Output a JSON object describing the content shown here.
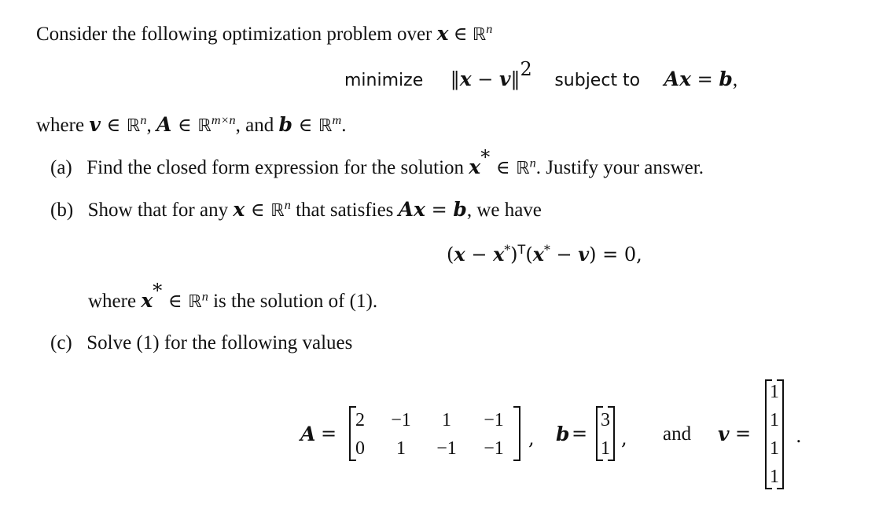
{
  "intro": {
    "text": "Consider the following optimization problem over",
    "var": "x",
    "in": "∈",
    "set": "ℝ",
    "set_exp": "n"
  },
  "problem": {
    "minimize": "minimize",
    "objective_open": "‖",
    "objective_x": "x",
    "objective_minus": " − ",
    "objective_v": "v",
    "objective_close": "‖",
    "objective_exp": "2",
    "subject_to": "subject to",
    "constraint_A": "A",
    "constraint_x": "x",
    "constraint_eq": " = ",
    "constraint_b": "b",
    "constraint_end": ","
  },
  "where_line": {
    "where": "where",
    "v": "v",
    "in": " ∈ ",
    "Rn": "ℝ",
    "n": "n",
    "comma1": ", ",
    "A": "A",
    "Rmn": "ℝ",
    "mxn": "m×n",
    "and": ", and ",
    "b": "b",
    "Rm": "ℝ",
    "m": "m",
    "end": "."
  },
  "parts": {
    "a": {
      "label": "(a)",
      "text": "Find the closed form expression for the solution",
      "var": "x",
      "star": "*",
      "in": " ∈ ",
      "set": "ℝ",
      "exp": "n",
      "tail": ". Justify your answer."
    },
    "b": {
      "label": "(b)",
      "text1": "Show that for any",
      "var": "x",
      "in": " ∈ ",
      "set": "ℝ",
      "exp": "n",
      "text2": "that satisfies",
      "A": "A",
      "x2": "x",
      "eq": " = ",
      "b": "b",
      "tail": ", we have",
      "equation": {
        "p1": "(",
        "x": "x",
        "minus": " − ",
        "xs": "x",
        "star": "*",
        "p2": ")",
        "T": "T",
        "p3": "(",
        "xs2": "x",
        "star2": "*",
        "minus2": " − ",
        "v": "v",
        "p4": ")",
        "rhs": " = 0,"
      },
      "where_text": "where",
      "where_var": "x",
      "where_star": "*",
      "where_in": " ∈ ",
      "where_set": "ℝ",
      "where_exp": "n",
      "where_tail": "is the solution of (1)."
    },
    "c": {
      "label": "(c)",
      "text": "Solve (1) for the following values"
    }
  },
  "values": {
    "A_label": "A",
    "A_eq": "=",
    "A": [
      [
        "2",
        "−1",
        "1",
        "−1"
      ],
      [
        "0",
        "1",
        "−1",
        "−1"
      ]
    ],
    "comma1": ",",
    "b_label": "b",
    "b_eq": "=",
    "b": [
      "3",
      "1"
    ],
    "comma2": ",",
    "and": "and",
    "v_label": "v",
    "v_eq": "=",
    "v": [
      "1",
      "1",
      "1",
      "1"
    ],
    "end": "."
  }
}
